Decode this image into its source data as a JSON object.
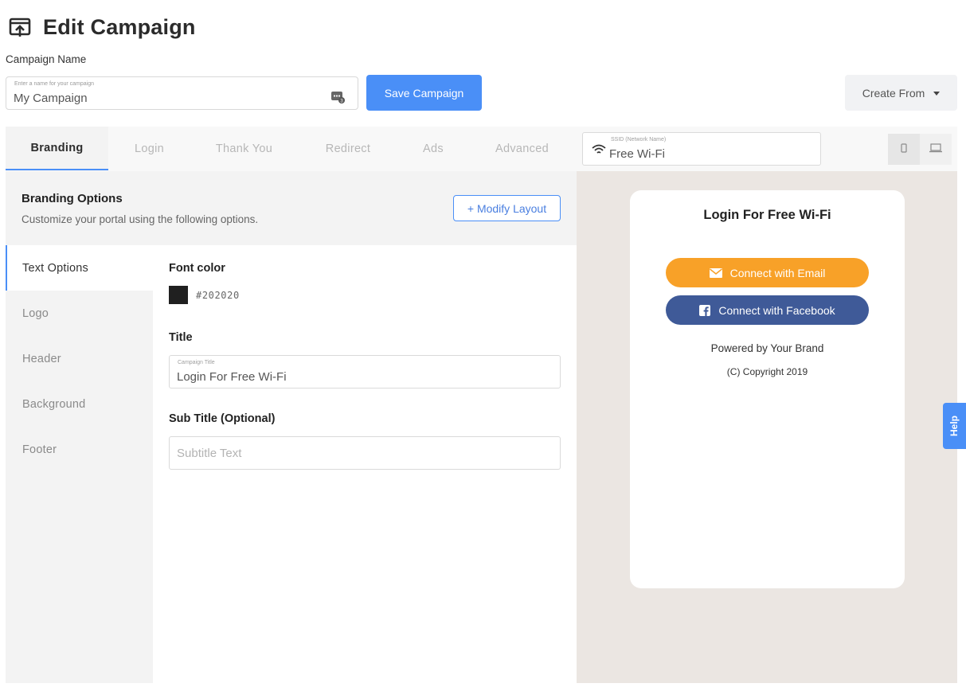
{
  "page": {
    "title": "Edit Campaign"
  },
  "campaign_name": {
    "label": "Campaign Name",
    "placeholder_hint": "Enter a name for your campaign",
    "value": "My Campaign"
  },
  "toolbar": {
    "save_label": "Save Campaign",
    "create_from_label": "Create From"
  },
  "tabs": [
    {
      "label": "Branding",
      "active": true
    },
    {
      "label": "Login"
    },
    {
      "label": "Thank You"
    },
    {
      "label": "Redirect"
    },
    {
      "label": "Ads"
    },
    {
      "label": "Advanced"
    }
  ],
  "ssid": {
    "hint": "SSID (Network Name)",
    "value": "Free Wi-Fi"
  },
  "branding": {
    "title": "Branding Options",
    "subtitle": "Customize your portal using the following options.",
    "modify_label": "+ Modify Layout"
  },
  "side_nav": [
    {
      "label": "Text Options",
      "active": true
    },
    {
      "label": "Logo"
    },
    {
      "label": "Header"
    },
    {
      "label": "Background"
    },
    {
      "label": "Footer"
    }
  ],
  "form": {
    "font_color_label": "Font color",
    "font_color_value": "#202020",
    "title_label": "Title",
    "title_hint": "Campaign Title",
    "title_value": "Login For Free Wi-Fi",
    "subtitle_label": "Sub Title (Optional)",
    "subtitle_placeholder": "Subtitle Text"
  },
  "preview": {
    "title": "Login For Free Wi-Fi",
    "email_button": "Connect with Email",
    "facebook_button": "Connect with Facebook",
    "powered_by": "Powered by Your Brand",
    "copyright": "(C) Copyright 2019"
  },
  "help": {
    "label": "Help"
  },
  "colors": {
    "accent": "#4a8ff7",
    "email_button": "#f8a128",
    "facebook_button": "#3f5a98",
    "preview_bg": "#ebe6e2"
  }
}
